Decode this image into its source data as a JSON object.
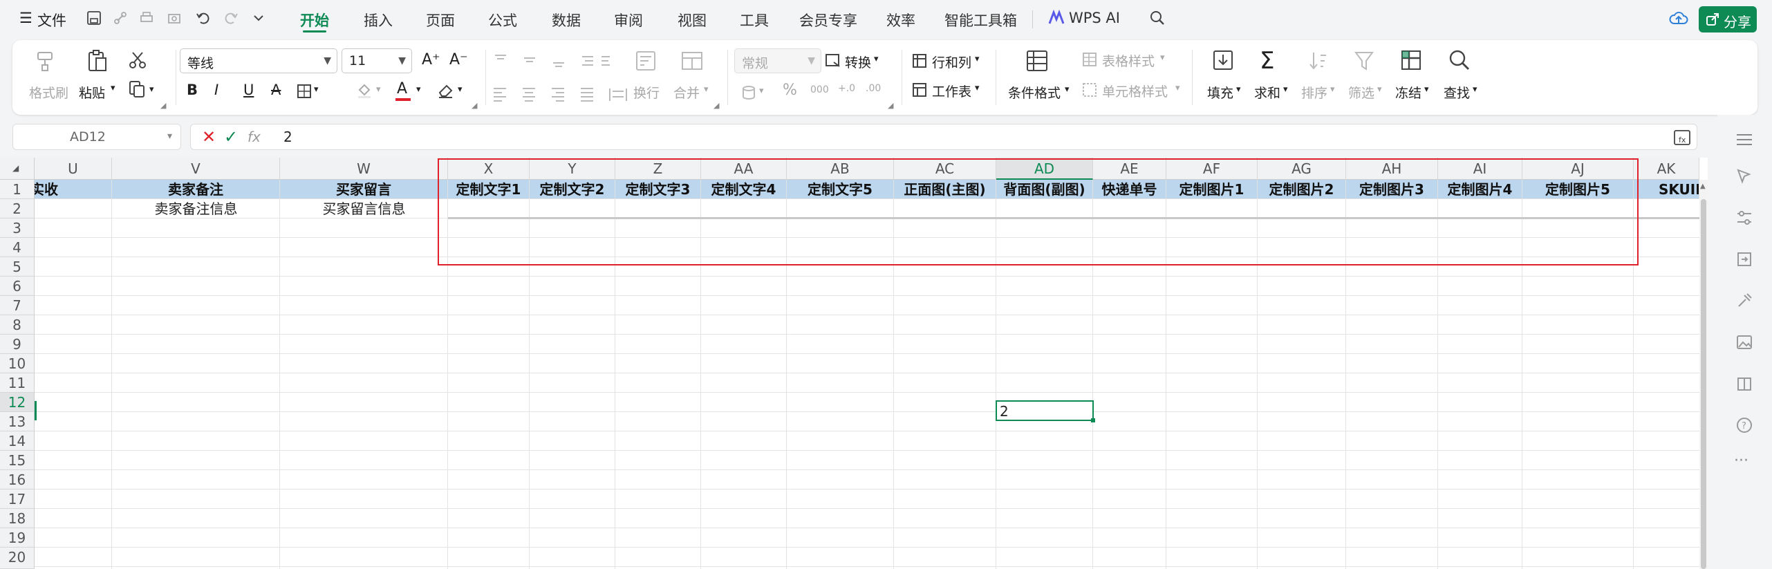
{
  "menubar": {
    "file_label": "文件",
    "tabs": [
      "开始",
      "插入",
      "页面",
      "公式",
      "数据",
      "审阅",
      "视图",
      "工具",
      "会员专享",
      "效率",
      "智能工具箱"
    ],
    "active_tab": "开始",
    "wps_ai_label": "WPS AI",
    "share_label": "分享"
  },
  "ribbon": {
    "format_painter": "格式刷",
    "paste": "粘贴",
    "font_name": "等线",
    "font_size": "11",
    "bold": "B",
    "italic": "I",
    "underline": "U",
    "strike": "A",
    "wrap": "换行",
    "merge": "合并",
    "number_format": "常规",
    "convert": "转换",
    "row_col": "行和列",
    "worksheet": "工作表",
    "cond_format": "条件格式",
    "table_style": "表格样式",
    "cell_style": "单元格样式",
    "fill": "填充",
    "sum": "求和",
    "sort": "排序",
    "filter": "筛选",
    "freeze": "冻结",
    "find": "查找",
    "percent": "%",
    "thousands": "000"
  },
  "formula_bar": {
    "name_box": "AD12",
    "fx": "fx",
    "value": "2"
  },
  "sheet": {
    "columns": [
      "U",
      "V",
      "W",
      "X",
      "Y",
      "Z",
      "AA",
      "AB",
      "AC",
      "AD",
      "AE",
      "AF",
      "AG",
      "AH",
      "AI",
      "AJ",
      "AK"
    ],
    "header_row": [
      "实收",
      "卖家备注",
      "买家留言",
      "定制文字1",
      "定制文字2",
      "定制文字3",
      "定制文字4",
      "定制文字5",
      "正面图(主图)",
      "背面图(副图)",
      "快递单号",
      "定制图片1",
      "定制图片2",
      "定制图片3",
      "定制图片4",
      "定制图片5",
      "SKUII"
    ],
    "row2": {
      "V": "卖家备注信息",
      "W": "买家留言信息"
    },
    "rows": [
      "1",
      "2",
      "3",
      "4",
      "5",
      "6",
      "7",
      "8",
      "9",
      "10",
      "11",
      "12",
      "13",
      "14",
      "15",
      "16",
      "17",
      "18",
      "19",
      "20"
    ],
    "active_cell_value": "2",
    "selected_column": "AD",
    "selected_row": "12"
  },
  "colors": {
    "accent": "#0e8a55",
    "header_fill": "#bcd6ee",
    "highlight_box": "#e0202a"
  }
}
